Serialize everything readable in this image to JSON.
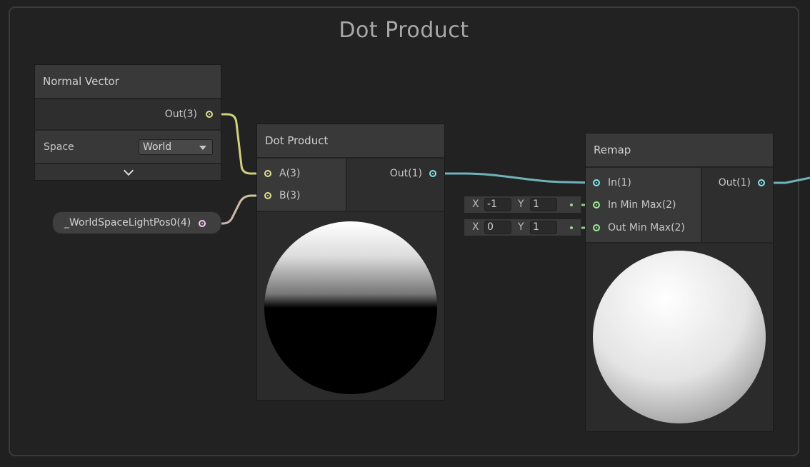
{
  "group": {
    "title": "Dot Product"
  },
  "colors": {
    "vector3": "#e0e28f",
    "vector1": "#84e4e7",
    "vector4": "#fbcbf4",
    "vector2": "#9aef92"
  },
  "normal_vector_node": {
    "title": "Normal Vector",
    "output_label": "Out(3)",
    "space_label": "Space",
    "space_value": "World",
    "expand_icon": "chevron-down-icon"
  },
  "property_node": {
    "label": "_WorldSpaceLightPos0(4)"
  },
  "dot_product_node": {
    "title": "Dot Product",
    "input_a": "A(3)",
    "input_b": "B(3)",
    "output_label": "Out(1)"
  },
  "remap_node": {
    "title": "Remap",
    "input_in": "In(1)",
    "input_in_min_max": "In Min Max(2)",
    "input_out_min_max": "Out Min Max(2)",
    "output_label": "Out(1)"
  },
  "in_min_max_field": {
    "x_label": "X",
    "x_value": "-1",
    "y_label": "Y",
    "y_value": "1"
  },
  "out_min_max_field": {
    "x_label": "X",
    "x_value": "0",
    "y_label": "Y",
    "y_value": "1"
  }
}
